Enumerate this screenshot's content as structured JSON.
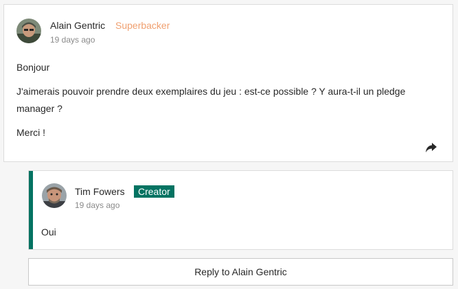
{
  "comment": {
    "author": "Alain Gentric",
    "badge": "Superbacker",
    "time": "19 days ago",
    "paragraphs": [
      "Bonjour",
      "J'aimerais pouvoir prendre deux exemplaires du jeu : est-ce possible ? Y aura-t-il un pledge manager ?",
      "Merci !"
    ],
    "share_icon": "share-arrow-icon"
  },
  "reply": {
    "author": "Tim Fowers",
    "badge": "Creator",
    "time": "19 days ago",
    "text": "Oui"
  },
  "reply_button": {
    "label": "Reply to Alain Gentric"
  },
  "colors": {
    "creator_green": "#037362",
    "superbacker_orange": "#f0a070"
  }
}
